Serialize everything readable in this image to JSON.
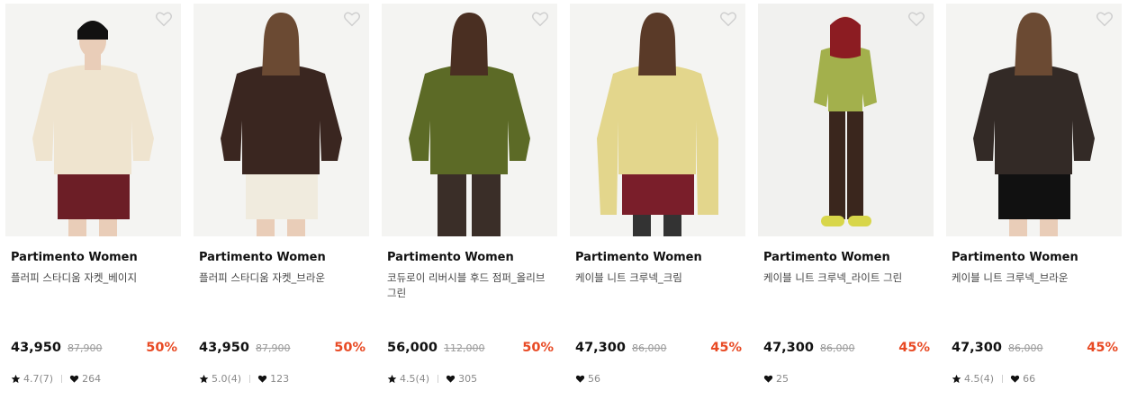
{
  "products": [
    {
      "brand": "Partimento Women",
      "name": "플러피 스타디움 자켓_베이지",
      "price": "43,950",
      "original_price": "87,900",
      "discount": "50%",
      "rating": "4.7(7)",
      "likes": "264",
      "colors": {
        "top": "#efe4cf",
        "bottom": "#6c1e26",
        "hair": "#111111",
        "bg": "#f4f4f2"
      }
    },
    {
      "brand": "Partimento Women",
      "name": "플러피 스타디움 자켓_브라운",
      "price": "43,950",
      "original_price": "87,900",
      "discount": "50%",
      "rating": "5.0(4)",
      "likes": "123",
      "colors": {
        "top": "#3a2620",
        "bottom": "#f0ebde",
        "hair": "#6b4a33",
        "bg": "#f4f4f2"
      }
    },
    {
      "brand": "Partimento Women",
      "name": "코듀로이 리버시블 후드 점퍼_올리브그린",
      "price": "56,000",
      "original_price": "112,000",
      "discount": "50%",
      "rating": "4.5(4)",
      "likes": "305",
      "colors": {
        "top": "#5c6a26",
        "bottom": "#3a2e28",
        "hair": "#4a2f22",
        "bg": "#f4f4f2"
      }
    },
    {
      "brand": "Partimento Women",
      "name": "케이블 니트 크루넥_크림",
      "price": "47,300",
      "original_price": "86,000",
      "discount": "45%",
      "rating": "",
      "likes": "56",
      "colors": {
        "top": "#e3d68c",
        "bottom": "#7a1e2a",
        "hair": "#5a3a28",
        "bg": "#f4f4f2"
      }
    },
    {
      "brand": "Partimento Women",
      "name": "케이블 니트 크루넥_라이트 그린",
      "price": "47,300",
      "original_price": "86,000",
      "discount": "45%",
      "rating": "",
      "likes": "25",
      "colors": {
        "top": "#a3b04c",
        "bottom": "#3a261d",
        "hair": "#8c1c22",
        "bg": "#f1f1ef"
      }
    },
    {
      "brand": "Partimento Women",
      "name": "케이블 니트 크루넥_브라운",
      "price": "47,300",
      "original_price": "86,000",
      "discount": "45%",
      "rating": "4.5(4)",
      "likes": "66",
      "colors": {
        "top": "#332a26",
        "bottom": "#111111",
        "hair": "#6b4a33",
        "bg": "#f4f4f2"
      }
    }
  ],
  "icons": {
    "wishlist": "heart-outline-icon",
    "rating": "star-icon",
    "likes": "heart-filled-icon"
  }
}
